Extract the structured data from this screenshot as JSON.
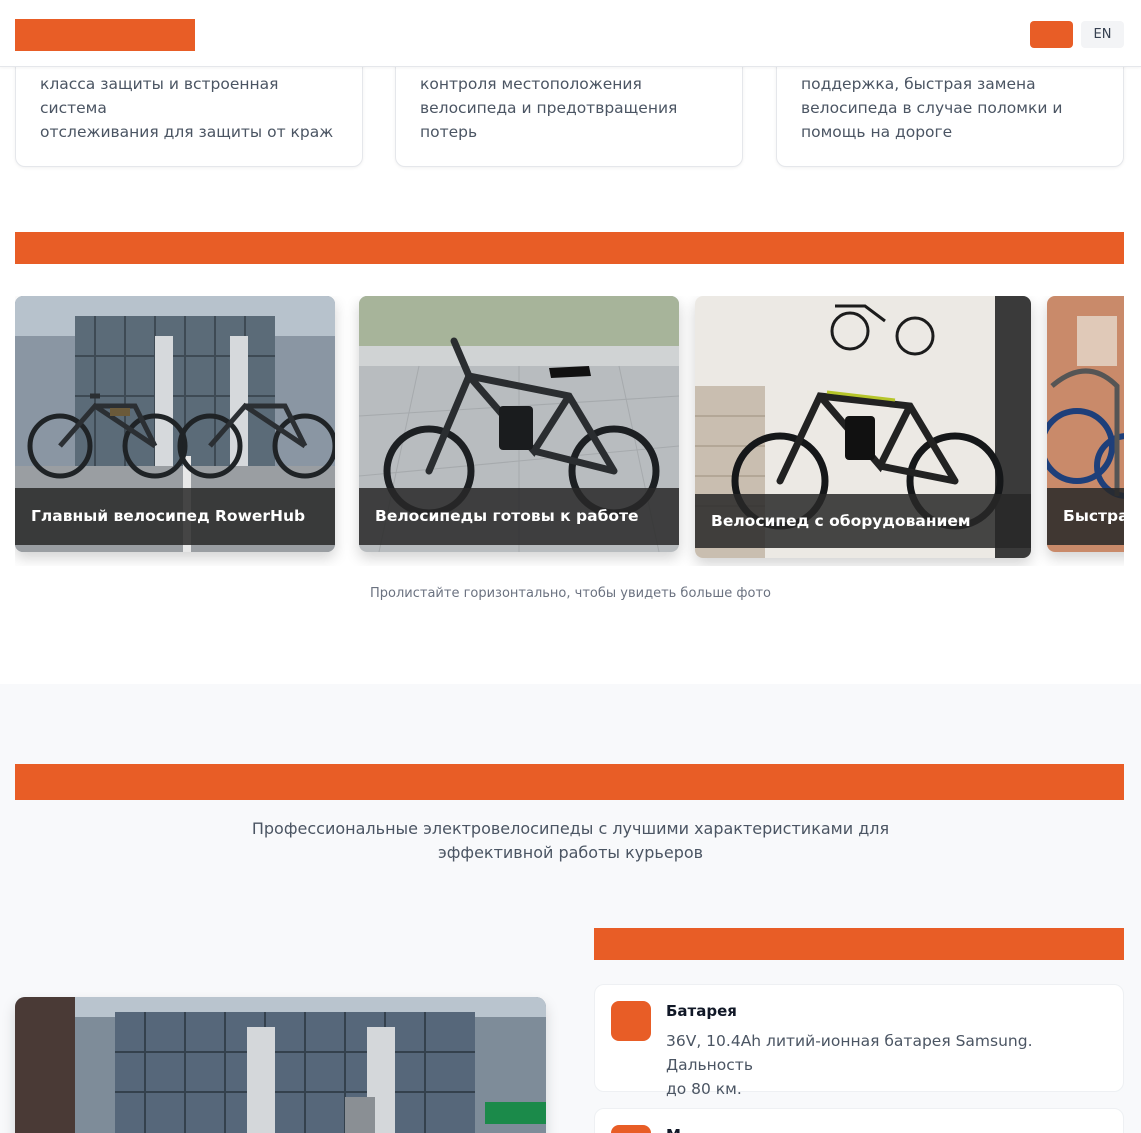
{
  "header": {
    "lang_en": "EN"
  },
  "features": [
    {
      "text_lines": [
        "класса защиты и встроенная система",
        "отслеживания для защиты от краж"
      ]
    },
    {
      "text_lines": [
        "контроля местоположения",
        "велосипеда и предотвращения",
        "потерь"
      ]
    },
    {
      "text_lines": [
        "поддержка, быстрая замена",
        "велосипеда в случае поломки и",
        "помощь на дороге"
      ]
    }
  ],
  "gallery": {
    "photos": [
      {
        "caption": "Главный велосипед RowerHub"
      },
      {
        "caption": "Велосипеды готовы к работе"
      },
      {
        "caption": "Велосипед с оборудованием"
      },
      {
        "caption": "Быстра"
      }
    ],
    "hint": "Пролистайте горизонтально, чтобы увидеть больше фото"
  },
  "specs": {
    "subtitle_line1": "Профессиональные электровелосипеды с лучшими характеристиками для",
    "subtitle_line2": "эффективной работы курьеров",
    "items": [
      {
        "name": "Батарея",
        "desc_line1": "36V, 10.4Ah литий-ионная батарея Samsung. Дальность",
        "desc_line2": "до 80 км."
      },
      {
        "name": "М"
      }
    ]
  },
  "colors": {
    "accent": "#e85d26",
    "section_bg": "#f8f9fb"
  }
}
